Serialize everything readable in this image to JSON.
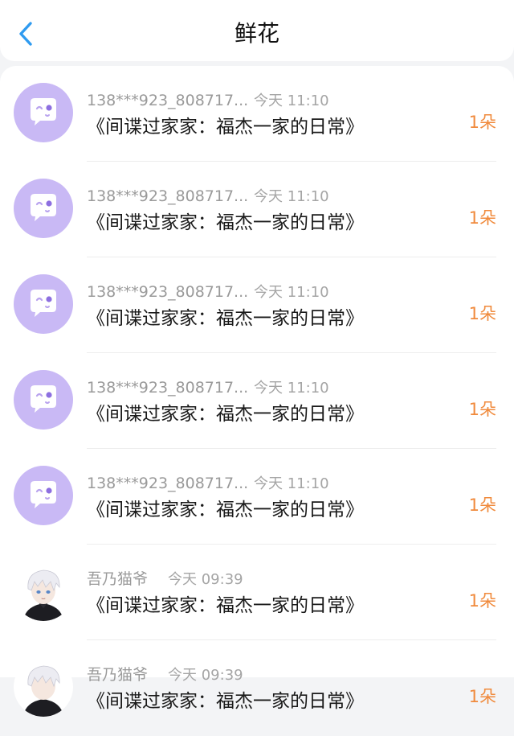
{
  "header": {
    "title": "鲜花",
    "back_icon": "chevron-left-icon",
    "accent": "#2f9bf0"
  },
  "colors": {
    "count": "#f08a3c",
    "avatar_default": "#c9b9f5"
  },
  "gifts": [
    {
      "user": "138***923_808717...",
      "time": "今天 11:10",
      "book": "《间谍过家家：福杰一家的日常》",
      "count": "1朵",
      "avatar": "default-avatar-icon"
    },
    {
      "user": "138***923_808717...",
      "time": "今天 11:10",
      "book": "《间谍过家家：福杰一家的日常》",
      "count": "1朵",
      "avatar": "default-avatar-icon"
    },
    {
      "user": "138***923_808717...",
      "time": "今天 11:10",
      "book": "《间谍过家家：福杰一家的日常》",
      "count": "1朵",
      "avatar": "default-avatar-icon"
    },
    {
      "user": "138***923_808717...",
      "time": "今天 11:10",
      "book": "《间谍过家家：福杰一家的日常》",
      "count": "1朵",
      "avatar": "default-avatar-icon"
    },
    {
      "user": "138***923_808717...",
      "time": "今天 11:10",
      "book": "《间谍过家家：福杰一家的日常》",
      "count": "1朵",
      "avatar": "default-avatar-icon"
    },
    {
      "user": "吾乃猫爷",
      "time": "今天 09:39",
      "book": "《间谍过家家：福杰一家的日常》",
      "count": "1朵",
      "avatar": "user-photo-avatar"
    },
    {
      "user": "吾乃猫爷",
      "time": "今天 09:39",
      "book": "《间谍过家家：福杰一家的日常》",
      "count": "1朵",
      "avatar": "user-photo-avatar"
    }
  ]
}
